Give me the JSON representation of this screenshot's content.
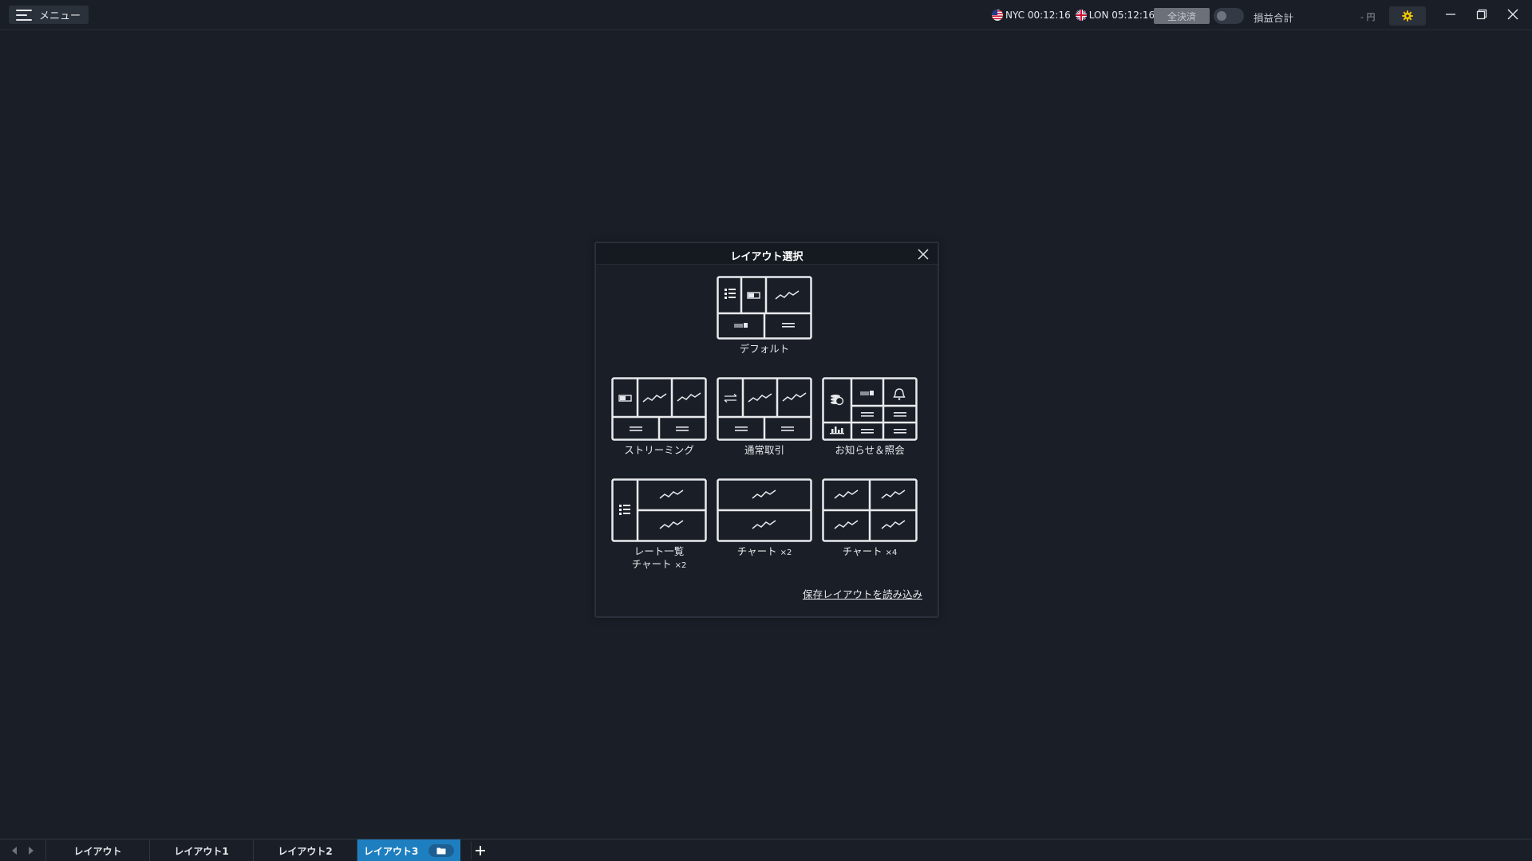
{
  "topbar": {
    "menu_label": "メニュー",
    "clock_nyc": "NYC 00:12:16",
    "clock_lon": "LON 05:12:16",
    "settle_all": "全決済",
    "pl_label": "損益合計",
    "pl_value": "- 円",
    "icons": {
      "menu": "hamburger-icon",
      "nyc": "us-flag-icon",
      "lon": "uk-flag-icon",
      "settings": "gear-icon",
      "minimize": "minimize-icon",
      "restore": "restore-icon",
      "close": "close-icon"
    },
    "accent_gear": "#f0c400"
  },
  "dialog": {
    "title": "レイアウト選択",
    "options": [
      {
        "id": "default",
        "label": "デフォルト"
      },
      {
        "id": "streaming",
        "label": "ストリーミング"
      },
      {
        "id": "normal",
        "label": "通常取引"
      },
      {
        "id": "notice",
        "label": "お知らせ＆照会"
      },
      {
        "id": "rates_chart2",
        "label_line1": "レート一覧",
        "label_line2": "チャート",
        "label_mult": "×2"
      },
      {
        "id": "chart2",
        "label": "チャート",
        "label_mult": "×2"
      },
      {
        "id": "chart4",
        "label": "チャート",
        "label_mult": "×4"
      }
    ],
    "load_link": "保存レイアウトを読み込み"
  },
  "tabbar": {
    "tabs": [
      "レイアウト",
      "レイアウト1",
      "レイアウト2",
      "レイアウト3"
    ],
    "active_tab": 3,
    "active_color": "#1e7fc0"
  }
}
